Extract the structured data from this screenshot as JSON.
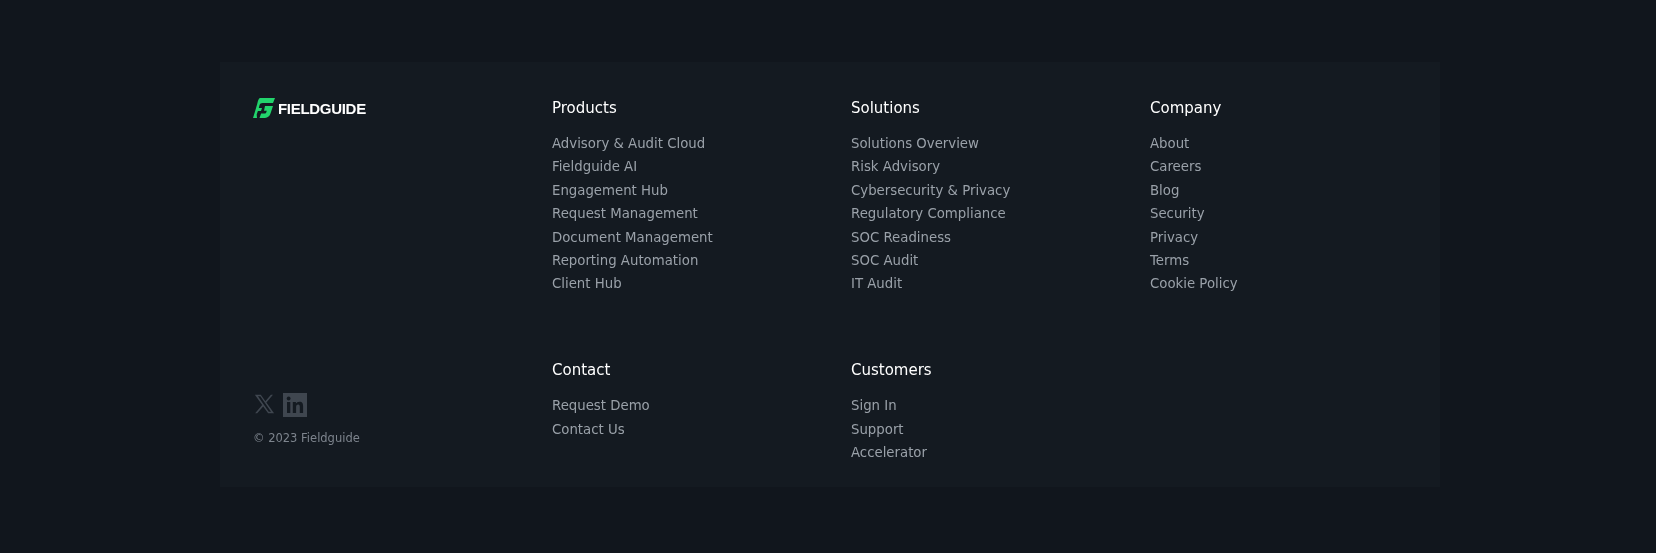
{
  "brand": {
    "name": "FIELDGUIDE"
  },
  "social": [
    {
      "kind": "x"
    },
    {
      "kind": "linkedin"
    }
  ],
  "copyright": "© 2023 Fieldguide",
  "sections": [
    {
      "title": "Products",
      "links": [
        "Advisory & Audit Cloud",
        "Fieldguide AI",
        "Engagement Hub",
        "Request Management",
        "Document Management",
        "Reporting Automation",
        "Client Hub"
      ]
    },
    {
      "title": "Solutions",
      "links": [
        "Solutions Overview",
        "Risk Advisory",
        "Cybersecurity & Privacy",
        "Regulatory Compliance",
        "SOC Readiness",
        "SOC Audit",
        "IT Audit"
      ]
    },
    {
      "title": "Company",
      "links": [
        "About",
        "Careers",
        "Blog",
        "Security",
        "Privacy",
        "Terms",
        "Cookie Policy"
      ]
    },
    {
      "title": "Contact",
      "links": [
        "Request Demo",
        "Contact Us"
      ]
    },
    {
      "title": "Customers",
      "links": [
        "Sign In",
        "Support",
        "Accelerator"
      ]
    }
  ]
}
